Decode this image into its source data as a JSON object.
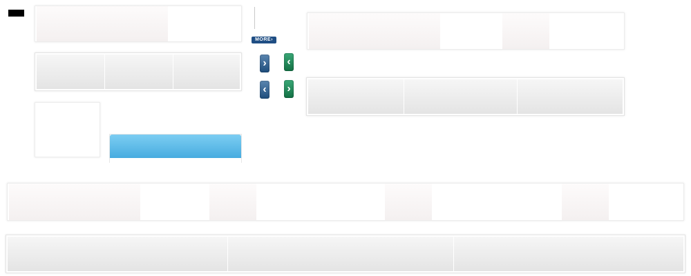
{
  "more_badge": {
    "label": "MORE",
    "arrow": "›"
  },
  "arrows": {
    "next_blue": "›",
    "prev_green": "‹",
    "prev_blue": "‹",
    "next_green": "›"
  },
  "colors": {
    "dark_badge": "#000000",
    "more_badge": "#1f4e84",
    "arrow_blue": "#1e4d7c",
    "arrow_green": "#137044",
    "header_blue": "#47ace0"
  }
}
